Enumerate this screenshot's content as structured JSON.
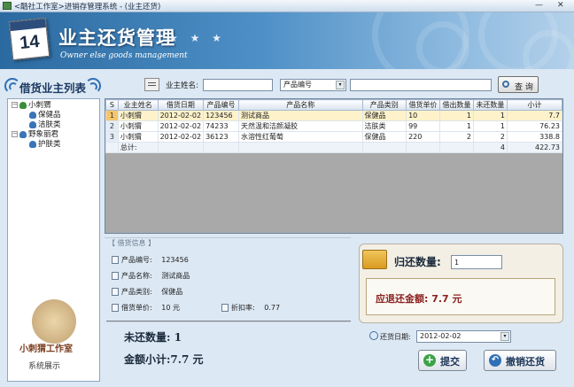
{
  "window": {
    "title": "<酷社工作室>进销存管理系统 - (业主还货)",
    "minimize": "—",
    "close": "✕"
  },
  "header": {
    "calendar_day": "14",
    "title": "业主还货管理",
    "stars": "★ ★ ★",
    "subtitle": "Owner else goods management"
  },
  "sidebar": {
    "title": "借货业主列表",
    "tree": [
      {
        "label": "小刺猬",
        "expander": "−",
        "children": [
          {
            "label": "保健品"
          },
          {
            "label": "洁肤类"
          }
        ]
      },
      {
        "label": "野象丽君",
        "expander": "−",
        "children": [
          {
            "label": "护肤类"
          }
        ]
      }
    ],
    "watermark": {
      "line1": "小刺猬工作室",
      "line2": "系统展示"
    }
  },
  "search": {
    "owner_label": "业主姓名:",
    "owner_value": "",
    "field_select": "产品编号",
    "keyword_value": "",
    "query_button": "查 询",
    "query_icon": "magnifier-icon",
    "select_arrow": "▾"
  },
  "grid": {
    "columns": [
      "业主姓名",
      "借货日期",
      "产品编号",
      "产品名称",
      "产品类别",
      "借货单价",
      "借出数量",
      "未还数量",
      "小计"
    ],
    "corner": "S",
    "rows": [
      {
        "index": "1",
        "owner": "小刺猬",
        "date": "2012-02-02",
        "code": "123456",
        "name": "测试商品",
        "category": "保健品",
        "price": "10",
        "lent": "1",
        "unreturned": "1",
        "subtotal": "7.7"
      },
      {
        "index": "2",
        "owner": "小刺猬",
        "date": "2012-02-02",
        "code": "74233",
        "name": "天然温和洁颜凝胶",
        "category": "洁肤类",
        "price": "99",
        "lent": "1",
        "unreturned": "1",
        "subtotal": "76.23"
      },
      {
        "index": "3",
        "owner": "小刺猬",
        "date": "2012-02-02",
        "code": "36123",
        "name": "水溶性红葡萄",
        "category": "保健品",
        "price": "220",
        "lent": "2",
        "unreturned": "2",
        "subtotal": "338.8"
      }
    ],
    "total": {
      "label": "总计:",
      "unreturned": "4",
      "subtotal": "422.73"
    }
  },
  "info": {
    "legend": "【 借货信息 】",
    "code_label": "产品编号:",
    "code_value": "123456",
    "name_label": "产品名称:",
    "name_value": "测试商品",
    "category_label": "产品类别:",
    "category_value": "保健品",
    "price_label": "借货单价:",
    "price_value": "10 元",
    "discount_label": "折扣率:",
    "discount_value": "0.77",
    "unreturned_text": "未还数量: 1",
    "subtotal_text": "金额小计:7.7 元"
  },
  "return_panel": {
    "qty_label": "归还数量:",
    "qty_value": "1",
    "refund_text": "应退还金额: 7.7 元",
    "date_label": "还货日期:",
    "date_value": "2012-02-02",
    "submit_button": "提交",
    "cancel_button": "撤销还货"
  }
}
